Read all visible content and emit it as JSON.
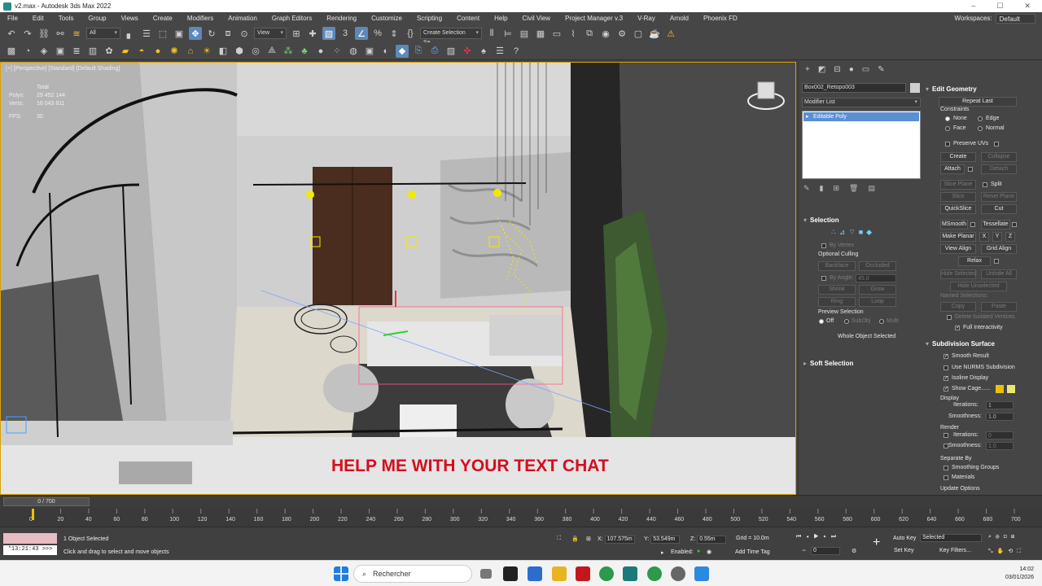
{
  "window": {
    "title": "v2.max - Autodesk 3ds Max 2022",
    "controls": [
      "–",
      "☐",
      "✕"
    ]
  },
  "menu": {
    "items": [
      "File",
      "Edit",
      "Tools",
      "Group",
      "Views",
      "Create",
      "Modifiers",
      "Animation",
      "Graph Editors",
      "Rendering",
      "Customize",
      "Scripting",
      "Content",
      "Help",
      "Civil View",
      "Project Manager v.3",
      "V-Ray",
      "Arnold",
      "Phoenix FD"
    ],
    "workspaces_label": "Workspaces:",
    "workspaces_value": "Default"
  },
  "toolbar": {
    "filter_value": "All",
    "refcoord_value": "View",
    "selection_set_placeholder": "Create Selection Se"
  },
  "viewport": {
    "label": "[+] [Perspective] [Standard] [Default Shading]",
    "stats": {
      "total_label": "Total",
      "polys_label": "Polys:",
      "polys_value": "29 452 144",
      "verts_label": "Verts:",
      "verts_value": "16 043 811",
      "fps_label": "FPS:",
      "fps_value": "30"
    },
    "overlay_text": "HELP ME WITH YOUR TEXT CHAT"
  },
  "command_panel": {
    "object_name": "Box002_Retopo003",
    "object_color": "#cfcfcf",
    "modifier_list": "Modifier List",
    "stack_items": [
      "Editable Poly"
    ],
    "selection": {
      "title": "Selection",
      "by_vertex": "By Vertex",
      "optional_culling": "Optional Culling",
      "backface": "Backface",
      "occluded": "Occluded",
      "by_angle": "By Angle:",
      "by_angle_value": "45.0",
      "shrink": "Shrink",
      "grow": "Grow",
      "ring": "Ring",
      "loop": "Loop",
      "preview_selection": "Preview Selection",
      "off": "Off",
      "subobj": "SubObj",
      "multi": "Multi",
      "whole_object": "Whole Object Selected"
    },
    "soft_selection": {
      "title": "Soft Selection"
    },
    "edit_geometry": {
      "title": "Edit Geometry",
      "repeat_last": "Repeat Last",
      "constraints": "Constraints",
      "none": "None",
      "edge": "Edge",
      "face": "Face",
      "normal": "Normal",
      "preserve_uvs": "Preserve UVs",
      "create": "Create",
      "collapse": "Collapse",
      "attach": "Attach",
      "detach": "Detach",
      "slice_plane": "Slice Plane",
      "split": "Split",
      "slice": "Slice",
      "reset_plane": "Reset Plane",
      "quickslice": "QuickSlice",
      "cut": "Cut",
      "msmooth": "MSmooth",
      "tessellate": "Tessellate",
      "make_planar": "Make Planar",
      "x": "X",
      "y": "Y",
      "z": "Z",
      "view_align": "View Align",
      "grid_align": "Grid Align",
      "relax": "Relax",
      "hide_selected": "Hide Selected",
      "unhide_all": "Unhide All",
      "hide_unselected": "Hide Unselected",
      "named_selections": "Named Selections:",
      "copy": "Copy",
      "paste": "Paste",
      "delete_isolated": "Delete Isolated Vertices",
      "full_interactivity": "Full Interactivity"
    },
    "subdivision": {
      "title": "Subdivision Surface",
      "smooth_result": "Smooth Result",
      "use_nurms": "Use NURMS Subdivision",
      "isoline_display": "Isoline Display",
      "show_cage": "Show Cage......",
      "cage_color_1": "#e8c400",
      "cage_color_2": "#e8e870",
      "display": "Display",
      "iterations_label": "Iterations:",
      "display_iterations": "1",
      "smoothness_label": "Smoothness:",
      "display_smoothness": "1.0",
      "render": "Render",
      "render_iterations": "0",
      "render_smoothness": "1.0",
      "separate_by": "Separate By",
      "smoothing_groups": "Smoothing Groups",
      "materials": "Materials",
      "update_options": "Update Options"
    }
  },
  "timeline": {
    "slider": "0 / 700",
    "ticks": [
      "0",
      "20",
      "40",
      "60",
      "80",
      "100",
      "120",
      "140",
      "160",
      "180",
      "200",
      "220",
      "240",
      "260",
      "280",
      "300",
      "320",
      "340",
      "360",
      "380",
      "400",
      "420",
      "440",
      "460",
      "480",
      "500",
      "520",
      "540",
      "560",
      "580",
      "600",
      "620",
      "640",
      "660",
      "680",
      "700"
    ]
  },
  "status": {
    "selected": "1 Object Selected",
    "prompt": "Click and drag to select and move objects",
    "time": "*13:21:43 >>>",
    "x_label": "X:",
    "x_value": "107.575m",
    "y_label": "Y:",
    "y_value": "53.549m",
    "z_label": "Z:",
    "z_value": "0.55m",
    "grid": "Grid = 10.0m",
    "enabled": "Enabled:",
    "add_time_tag": "Add Time Tag",
    "auto_key": "Auto Key",
    "set_key": "Set Key",
    "selected_dd": "Selected",
    "key_filters": "Key Filters...",
    "frame": "0"
  },
  "taskbar": {
    "search": "Rechercher",
    "time": "14:02",
    "date": "03/01/2026"
  }
}
